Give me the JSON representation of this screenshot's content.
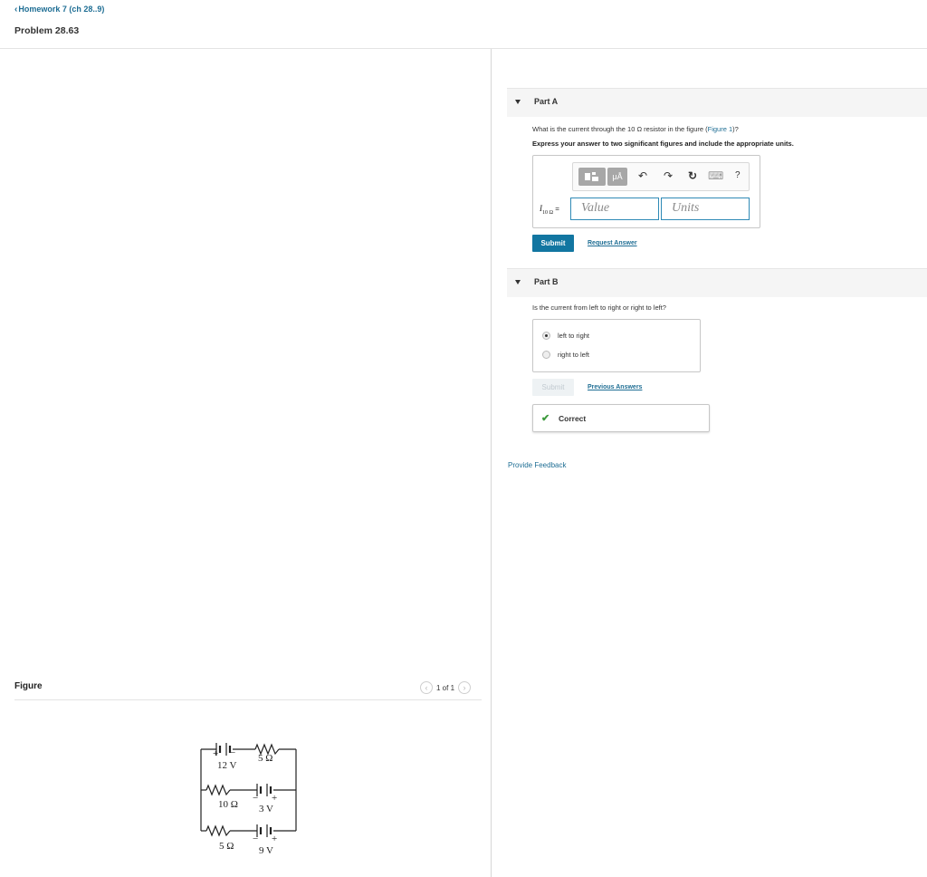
{
  "header": {
    "back_chevron": "‹",
    "back_label": "Homework 7 (ch 28..9)",
    "problem_title": "Problem 28.63"
  },
  "figure": {
    "label": "Figure",
    "pagination": "1 of 1",
    "prev_icon": "‹",
    "next_icon": "›",
    "circuit": {
      "emf_top": "12 V",
      "r_top": "5 Ω",
      "r_middle": "10 Ω",
      "emf_middle": "3 V",
      "r_bottom": "5 Ω",
      "emf_bottom": "9 V",
      "plus": "+",
      "minus": "−"
    }
  },
  "part_a": {
    "title": "Part A",
    "question_prefix": "What is the current through the 10 Ω resistor in the figure (",
    "figure_link": "Figure 1",
    "question_suffix": ")?",
    "instruction": "Express your answer to two significant figures and include the appropriate units.",
    "toolbar": {
      "units_button": "μÅ",
      "undo_icon": "↶",
      "redo_icon": "↷",
      "reset_icon": "↻",
      "keyboard_icon": "⌨",
      "help_icon": "?"
    },
    "variable_main": "I",
    "variable_sub": "10 Ω",
    "variable_eq": "=",
    "value_placeholder": "Value",
    "units_placeholder": "Units",
    "submit_label": "Submit",
    "request_answer_label": "Request Answer"
  },
  "part_b": {
    "title": "Part B",
    "question": "Is the current from left to right or right to left?",
    "options": [
      {
        "label": "left to right",
        "selected": true
      },
      {
        "label": "right to left",
        "selected": false
      }
    ],
    "submit_label": "Submit",
    "previous_answers_label": "Previous Answers",
    "status_icon": "✔",
    "status_text": "Correct"
  },
  "feedback_label": "Provide Feedback",
  "colors": {
    "link": "#1f6e94",
    "submit": "#1276a1",
    "correct": "#3d9a3d"
  }
}
